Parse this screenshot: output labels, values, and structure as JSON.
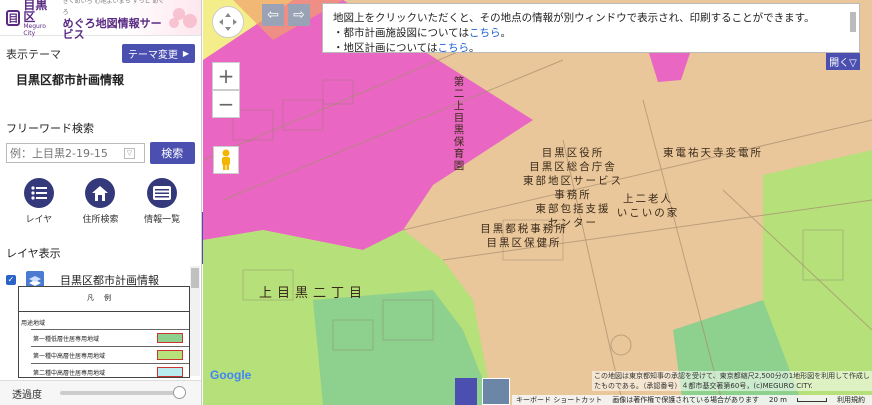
{
  "header": {
    "logo_mark": "目",
    "logo_name": "目黒区",
    "logo_sub": "Meguro City",
    "service_tagline": "きくめいろ 心地よいまち ずっと めぐろ",
    "service_title": "めぐろ地図情報サービス"
  },
  "theme": {
    "label": "表示テーマ",
    "change_button": "テーマ変更",
    "current": "目黒区都市計画情報"
  },
  "search": {
    "label": "フリーワード検索",
    "placeholder": "例：上目黒2-19-15",
    "button": "検索"
  },
  "tools": [
    {
      "label": "レイヤ",
      "icon": "layer-list-icon"
    },
    {
      "label": "住所検索",
      "icon": "house-icon"
    },
    {
      "label": "情報一覧",
      "icon": "info-list-icon"
    }
  ],
  "layers": {
    "header": "レイヤ表示",
    "items": [
      {
        "name": "目黒区都市計画情報",
        "checked": true
      }
    ]
  },
  "legend": {
    "title": "凡例",
    "category": "用途地域",
    "rows": [
      {
        "label": "第一種低層住居専用地域",
        "color": "#8ed08e"
      },
      {
        "label": "第一種中高層住居専用地域",
        "color": "#b5e07a"
      },
      {
        "label": "第二種中高層住居専用地域",
        "color": "#b9ecef"
      }
    ]
  },
  "opacity": {
    "label": "透過度",
    "value": 1.0
  },
  "notice": {
    "line1": "地図上をクリックいただくと、その地点の情報が別ウィンドウで表示され、印刷することができます。",
    "line2_prefix": "・都市計画施設図については",
    "line2_link": "こちら",
    "line2_suffix": "。",
    "line3_prefix": "・地区計画については",
    "line3_link": "こちら",
    "line3_suffix": "。",
    "open_button": "開く▽"
  },
  "map_controls": {
    "collapse": "«",
    "prev": "⇦",
    "next": "⇨",
    "zoom_in": "+",
    "zoom_out": "−"
  },
  "map_labels": {
    "school": "第二上目黒保育園",
    "ward_office": [
      "目黒区役所",
      "目黒区総合庁舎",
      "東部地区サービス",
      "事務所",
      "東部包括支援",
      "センター"
    ],
    "elder": [
      "上二老人",
      "いこいの家"
    ],
    "substation": "東電祐天寺変電所",
    "tax_office": [
      "目黒都税事務所",
      "目黒区保健所"
    ],
    "district": "上目黒二丁目"
  },
  "attribution": {
    "google": "Google",
    "copyright": "この地図は東京都知事の承認を受けて、東京都縮尺2,500分の1地形図を利用して作成したものである。（承認番号）４都市基交著第60号，(c)MEGURO CITY.",
    "keyboard": "キーボード ショートカット",
    "imagery": "画像は著作権で保護されている場合があります",
    "scale": "20 m",
    "terms": "利用規約"
  },
  "colors": {
    "accent": "#4a4fb0",
    "commercial": "#e966c2",
    "residential_mid": "#e9c79a",
    "residential_green": "#b5e07a",
    "residential_low": "#8ed08e",
    "industrial": "#f4ee8a"
  }
}
